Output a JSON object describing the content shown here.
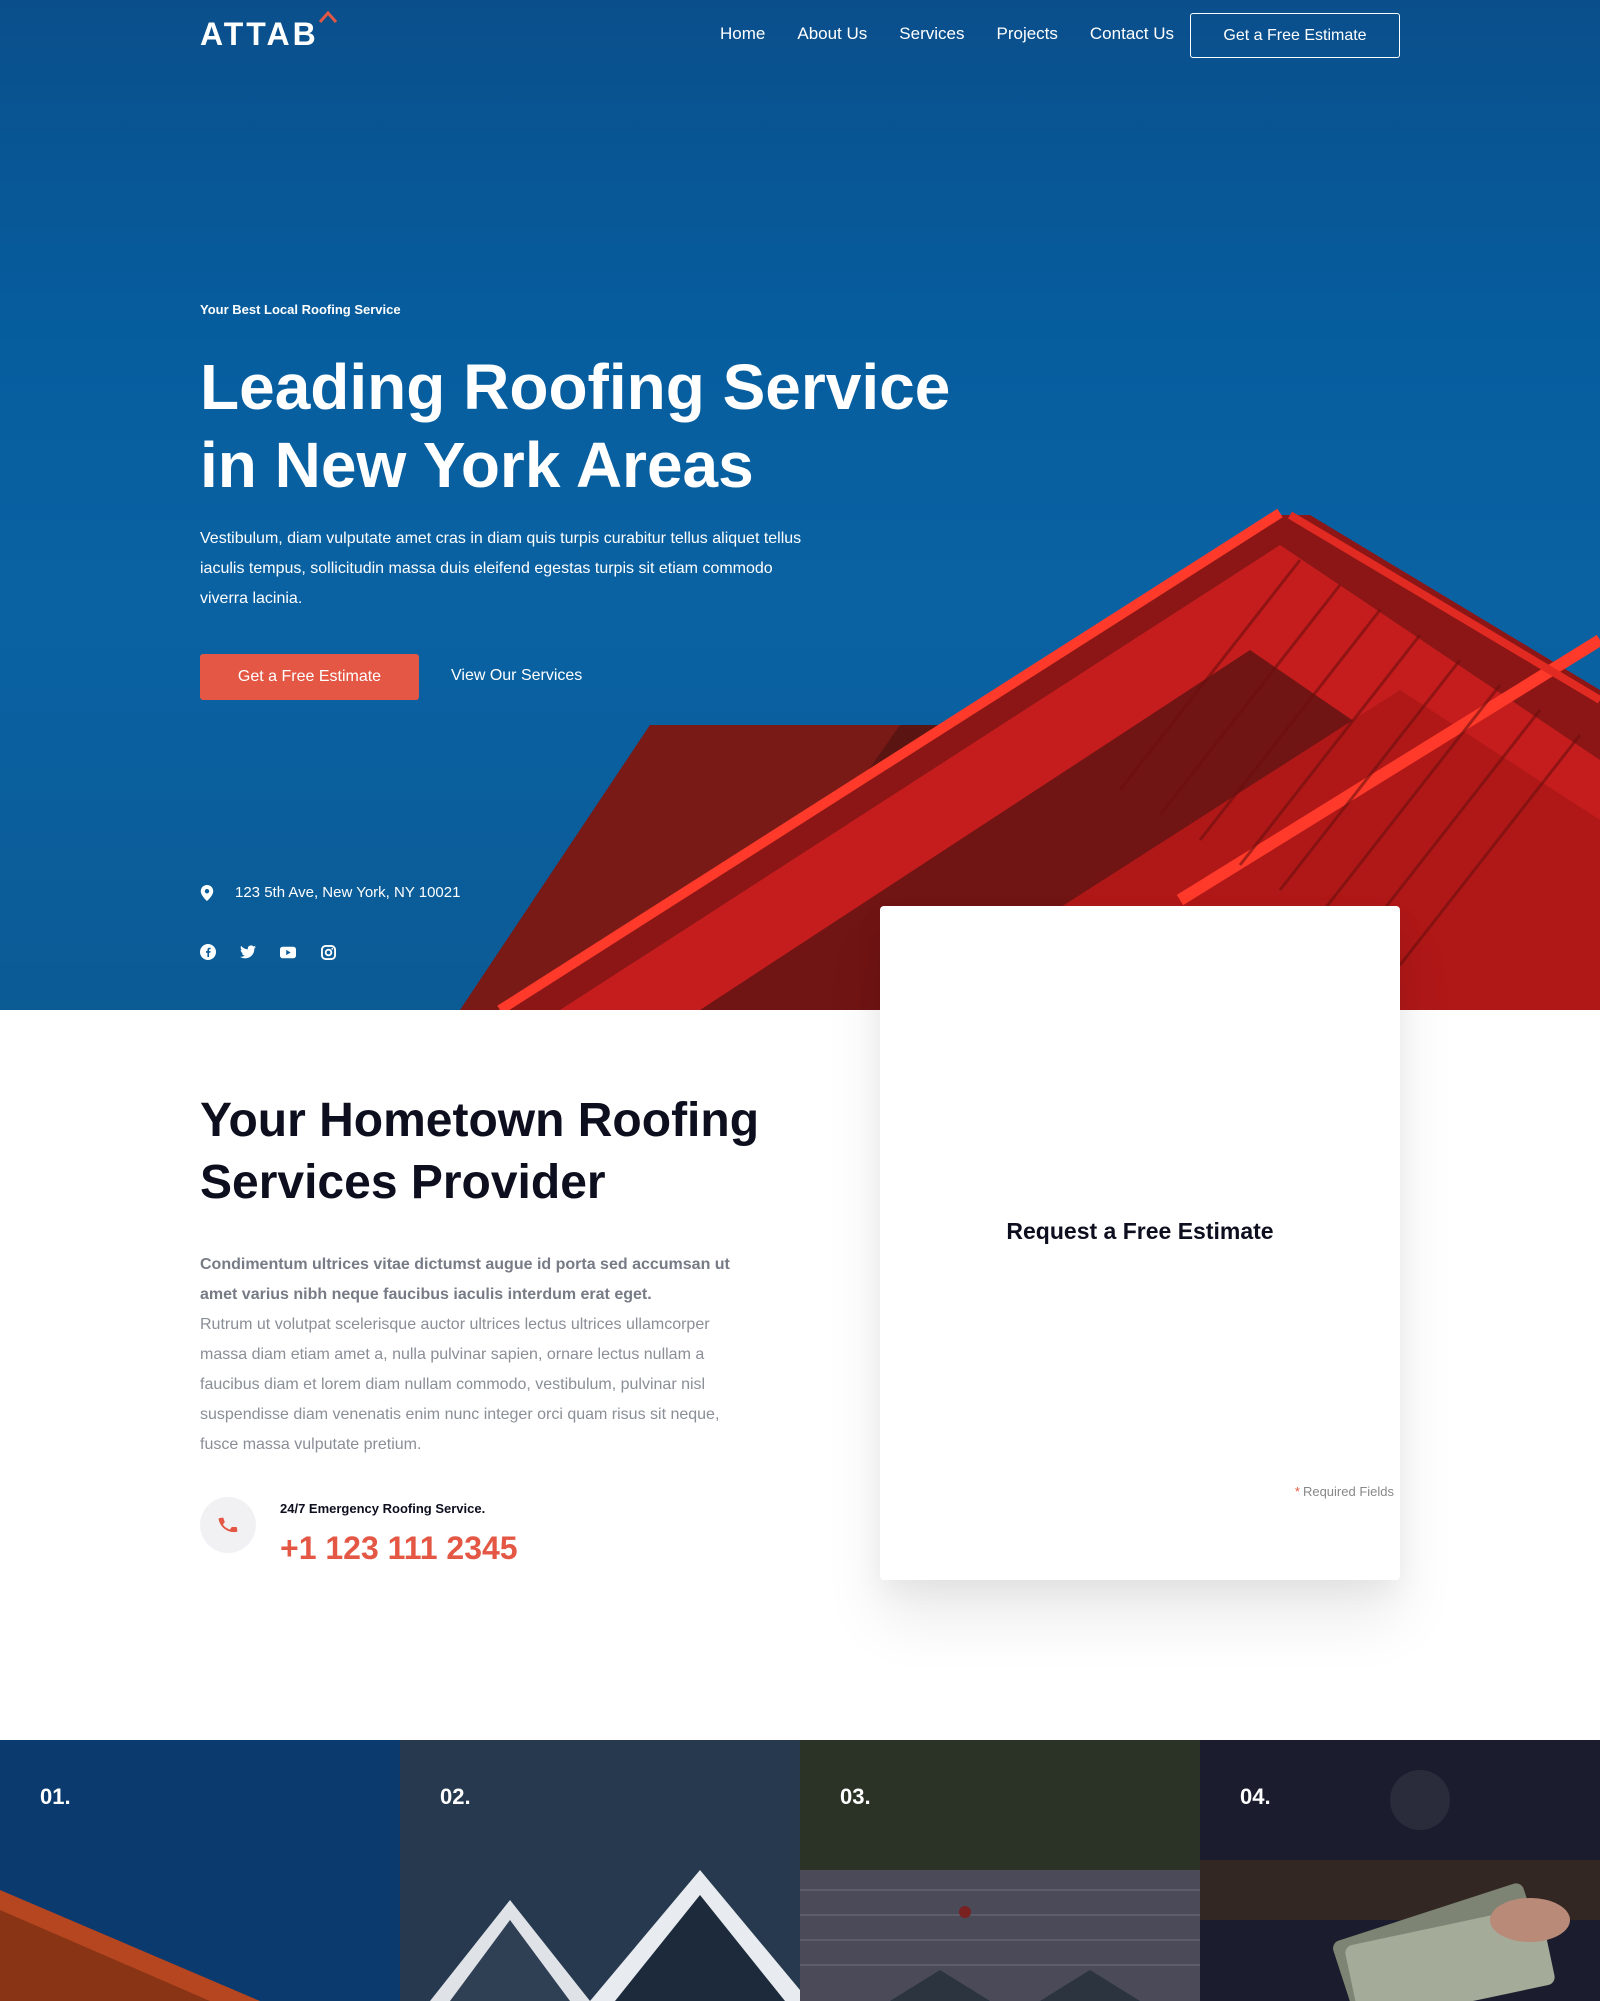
{
  "nav": {
    "logo": "ATTAB",
    "links": [
      "Home",
      "About Us",
      "Services",
      "Projects",
      "Contact Us"
    ],
    "cta": "Get a Free Estimate"
  },
  "hero": {
    "eyebrow": "Your Best Local Roofing Service",
    "title_line1": "Leading Roofing Service",
    "title_line2": "in New York Areas",
    "text": "Vestibulum, diam vulputate amet cras in diam quis turpis curabitur tellus aliquet tellus iaculis tempus, sollicitudin massa duis eleifend egestas turpis sit etiam commodo viverra lacinia.",
    "primary_button": "Get a Free Estimate",
    "secondary_button": "View Our Services",
    "address": "123 5th Ave, New York, NY 10021",
    "socials": [
      "facebook-icon",
      "twitter-icon",
      "youtube-icon",
      "instagram-icon"
    ]
  },
  "estimate_card": {
    "title": "Request a Free Estimate",
    "required_note": "Required Fields",
    "required_star": "*"
  },
  "about": {
    "title_line1": "Your Hometown Roofing",
    "title_line2": "Services Provider",
    "lead": "Condimentum ultrices vitae dictumst augue id porta sed accumsan ut amet varius nibh neque faucibus iaculis interdum erat eget.",
    "text": "Rutrum ut volutpat scelerisque auctor ultrices lectus ultrices ullamcorper massa diam etiam amet a, nulla pulvinar sapien, ornare lectus nullam a faucibus diam et lorem diam nullam commodo, vestibulum, pulvinar nisl suspendisse diam venenatis enim nunc integer orci quam risus sit neque, fusce massa vulputate pretium.",
    "emergency_label": "24/7 Emergency Roofing Service.",
    "phone": "+1 123 111 2345"
  },
  "services_strip": {
    "numbers": [
      "01.",
      "02.",
      "03.",
      "04."
    ]
  },
  "colors": {
    "accent": "#e35744",
    "hero_blue": "#065e9f",
    "heading": "#0d0f1f"
  }
}
